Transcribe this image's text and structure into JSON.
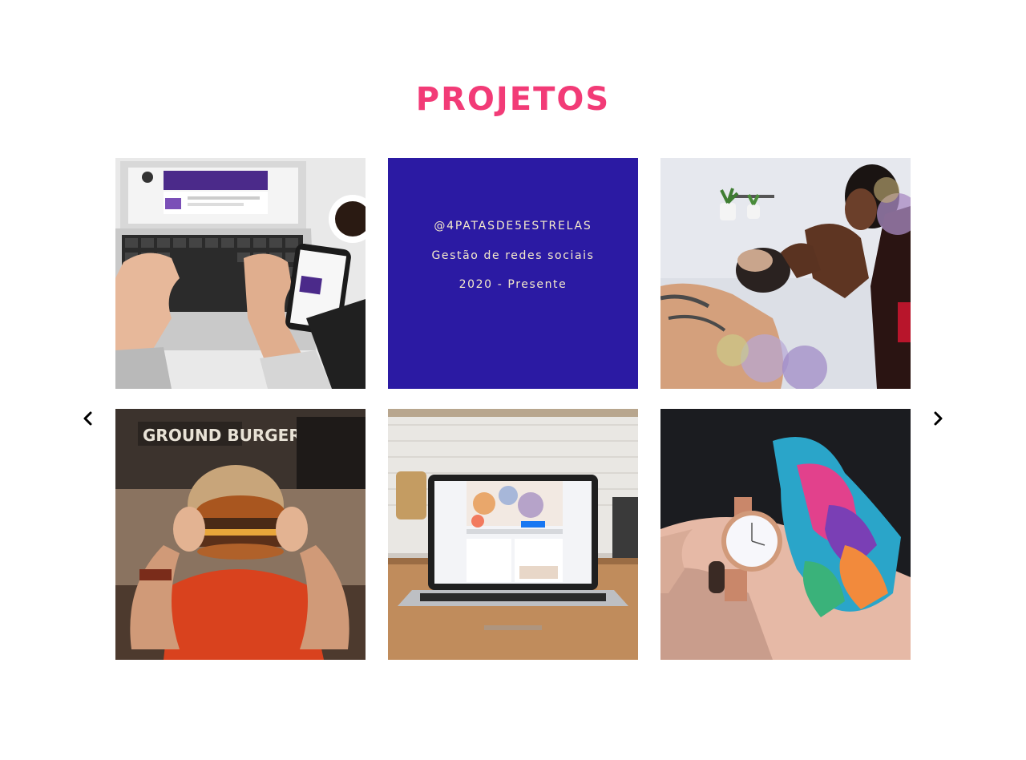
{
  "section": {
    "title": "PROJETOS",
    "title_color": "#f23b77"
  },
  "gallery": {
    "featured": {
      "handle": "@4PATASDE5ESTRELAS",
      "service": "Gestão de redes sociais",
      "period": "2020 - Presente",
      "background": "#2b1aa3",
      "text_color": "#f5eacb"
    },
    "tiles": [
      {
        "image": "laptop-typing-linkedin-photo"
      },
      {
        "image": "featured-text-tile"
      },
      {
        "image": "makeup-artist-photo"
      },
      {
        "image": "burger-photo"
      },
      {
        "image": "laptop-facebook-page-photo"
      },
      {
        "image": "watch-and-scarf-photo"
      }
    ],
    "nav": {
      "prev_icon": "chevron-left-icon",
      "next_icon": "chevron-right-icon"
    }
  }
}
